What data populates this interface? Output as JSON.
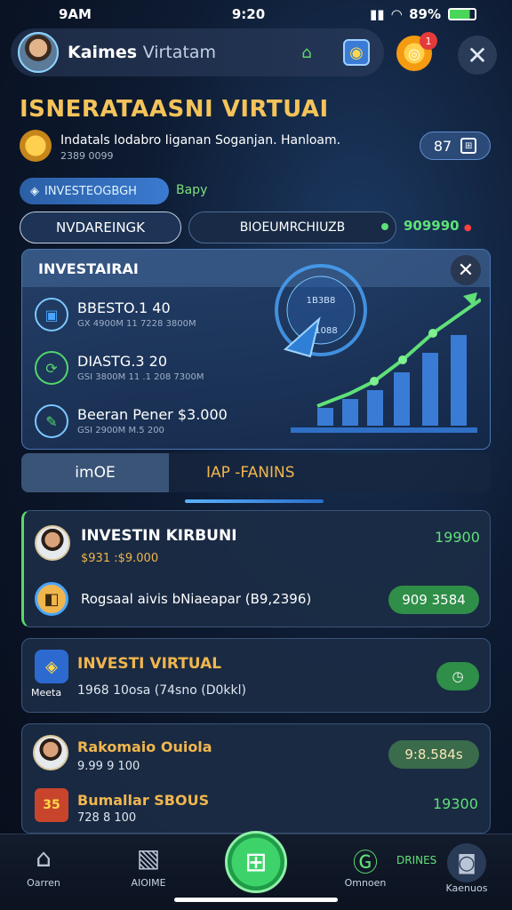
{
  "status": {
    "time": "9AM",
    "clock": "9:20",
    "battery": "89%"
  },
  "header": {
    "brand": "Kaimes",
    "brand_sub": "Virtatam",
    "notif_count": "1"
  },
  "page": {
    "title": "ISNERATAASNI VIRTUAI",
    "subtitle": "Indatals Iodabro Iiganan Soganjan. Hanloam.",
    "subtitle2": "2389 0099",
    "stat_value": "87"
  },
  "chips": {
    "invest": "INVESTEOGBGH",
    "apply": "Bapy"
  },
  "tabs": {
    "a": "NVDAREINGK",
    "b": "BIOEUMRCHIUZB",
    "value": "909990"
  },
  "panel": {
    "title": "INVESTAIRAI",
    "rows": [
      {
        "title": "BBESTO.1 40",
        "sub": "GX 4900M 11 7228 3800M",
        "icon_color": "#4aa6ff"
      },
      {
        "title": "DIASTG.3 20",
        "sub": "GSI 3800M 11 .1 208 7300M",
        "icon_color": "#52d66a"
      },
      {
        "title": "Beeran Pener $3.000",
        "sub": "GSI 2900M M.5 200",
        "icon_color": "#4aa6ff"
      }
    ],
    "dial_top": "1B3B8",
    "dial_mid": "1088"
  },
  "segment": {
    "a": "imOE",
    "b": "IAP -FANINS"
  },
  "cards": {
    "c1": {
      "name": "INVESTIN KIRBUNI",
      "sub": "$931 :$9.000",
      "value": "19900",
      "detail": "Rogsaal aivis bNiaeapar (B9,2396)",
      "pill": "909 3584"
    },
    "c2": {
      "name": "INVESTI VIRTUAL",
      "label": "Meeta",
      "sub": "1968 10osa (74sno (D0kkl)"
    },
    "c3": {
      "name": "Rakomaio Ouiola",
      "sub": "9.99 9 100",
      "pill": "9:8.584s",
      "name2": "Bumallar SBOUS",
      "sub2": "728 8 100",
      "value2": "19300",
      "badge": "35"
    }
  },
  "nav": {
    "item1": "Oarren",
    "item2": "AIOIME",
    "item3": "Omnoen",
    "item3_label": "DRINES",
    "item4": "Kaenuos"
  }
}
